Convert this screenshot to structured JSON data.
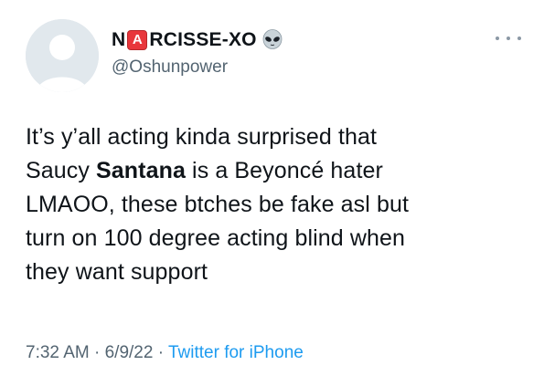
{
  "tweet": {
    "display_name_prefix": "N",
    "display_name_emoji_letter": "A",
    "display_name_suffix": "RCISSE-XO",
    "handle": "@Oshunpower",
    "body_lines": [
      "It’s y’all acting kinda surprised that",
      "Saucy ",
      "Santana",
      " is a Beyoncé hater",
      "LMAOO, these btches be fake asl but",
      "turn on 100 degree acting blind when",
      "they want support"
    ],
    "time": "7:32 AM",
    "separator": " · ",
    "date": "6/9/22",
    "source": "Twitter for iPhone"
  },
  "icons": {
    "avatar": "default-avatar-icon",
    "name_emoji": "a-button-emoji-icon",
    "name_alien": "alien-emoji-icon",
    "more": "more-options-icon"
  },
  "colors": {
    "text_primary": "#0f1419",
    "text_secondary": "#536471",
    "link": "#1d9bf0",
    "avatar_bg": "#e1e8ed",
    "badge_red": "#e8363b"
  }
}
